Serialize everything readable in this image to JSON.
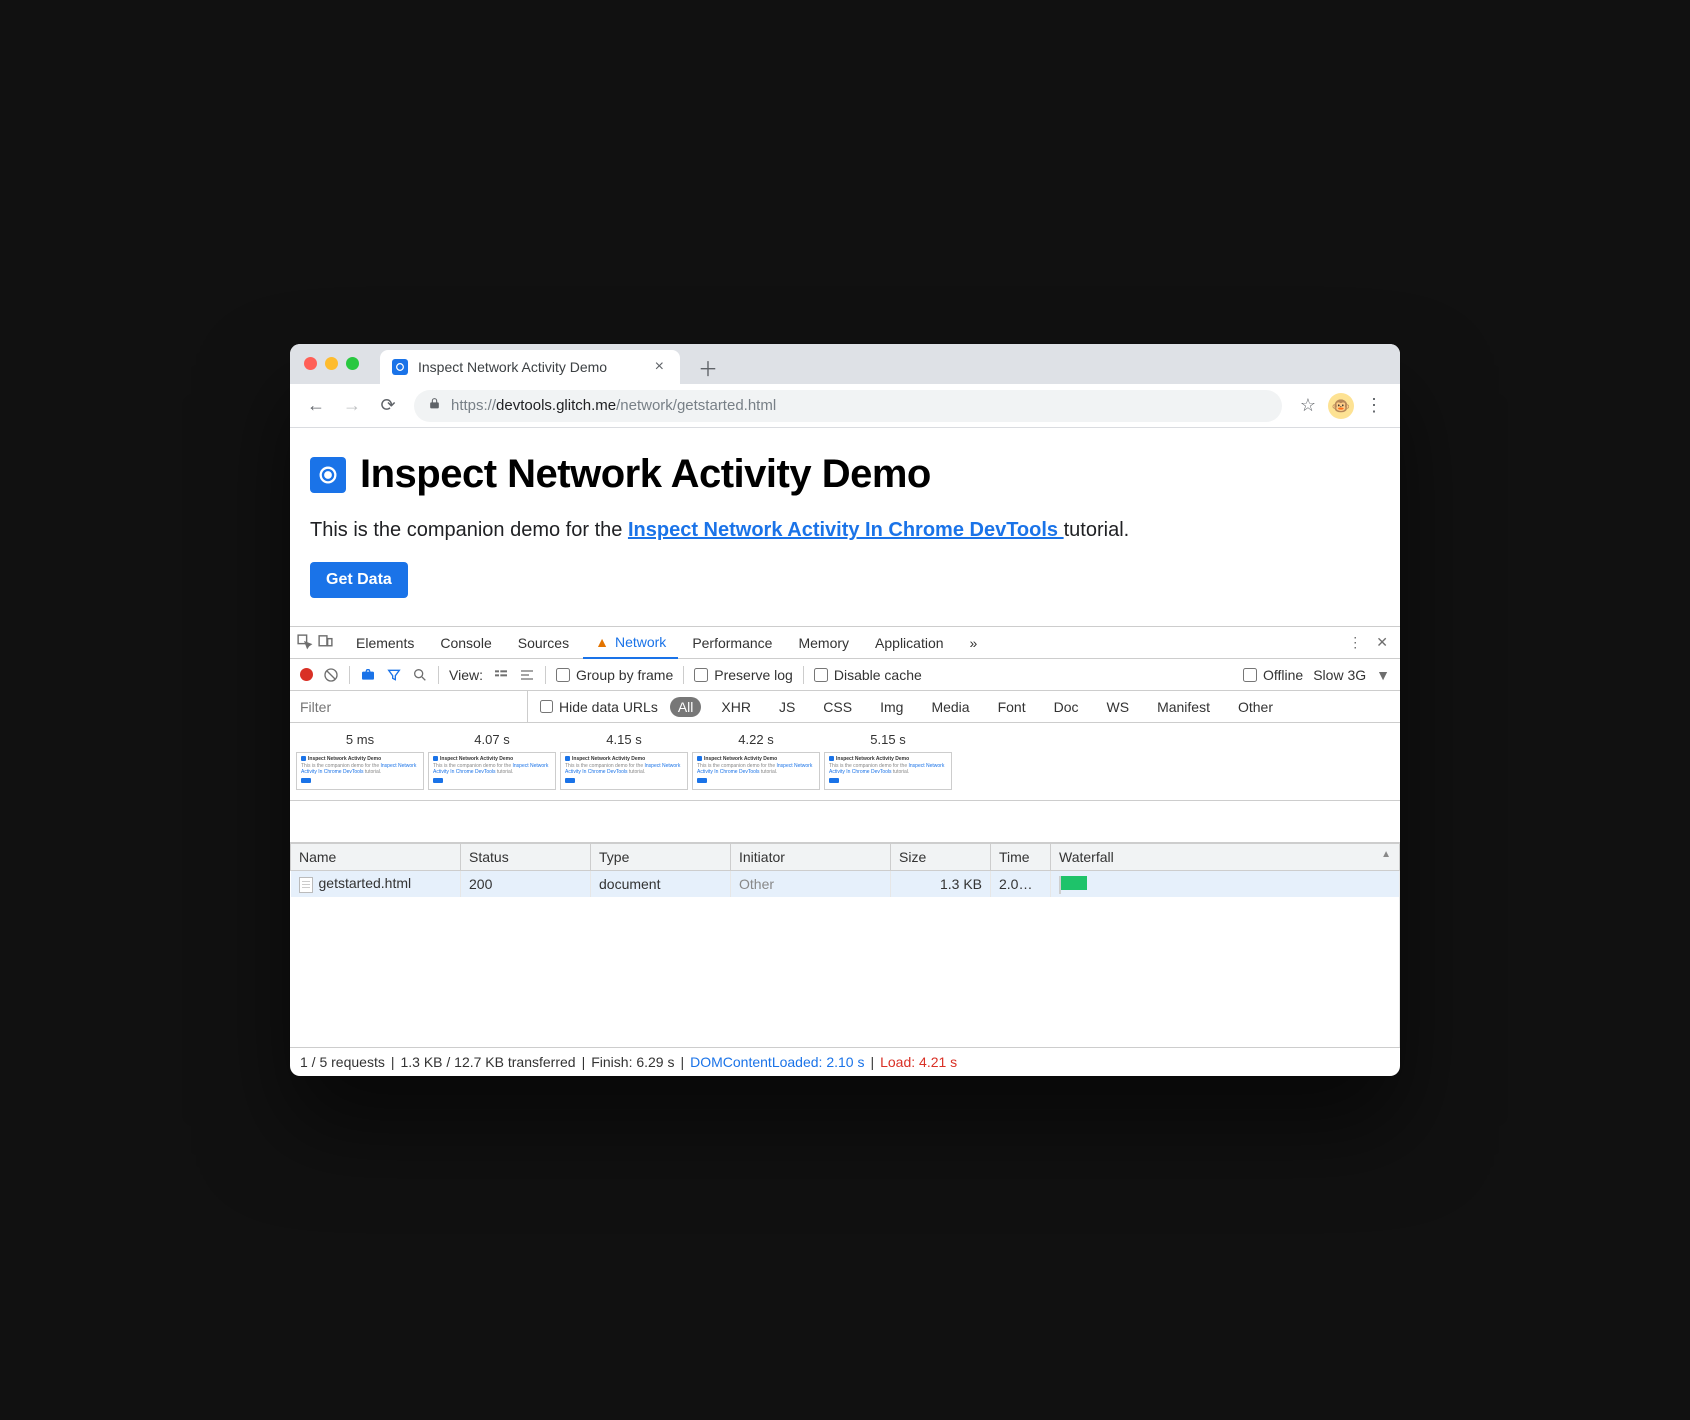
{
  "browser": {
    "tab_title": "Inspect Network Activity Demo",
    "url_display": {
      "scheme": "https://",
      "host": "devtools.glitch.me",
      "path": "/network/getstarted.html"
    }
  },
  "page": {
    "heading": "Inspect Network Activity Demo",
    "intro_prefix": "This is the companion demo for the ",
    "intro_link": "Inspect Network Activity In Chrome DevTools ",
    "intro_suffix": "tutorial.",
    "button": "Get Data"
  },
  "devtools": {
    "tabs": [
      "Elements",
      "Console",
      "Sources",
      "Network",
      "Performance",
      "Memory",
      "Application"
    ],
    "active_tab": "Network",
    "toolbar": {
      "view_label": "View:",
      "group_by_frame": "Group by frame",
      "preserve_log": "Preserve log",
      "disable_cache": "Disable cache",
      "offline": "Offline",
      "throttle": "Slow 3G"
    },
    "filterbar": {
      "placeholder": "Filter",
      "hide_data_urls": "Hide data URLs",
      "types": [
        "All",
        "XHR",
        "JS",
        "CSS",
        "Img",
        "Media",
        "Font",
        "Doc",
        "WS",
        "Manifest",
        "Other"
      ],
      "active_type": "All"
    },
    "filmstrip": [
      "5 ms",
      "4.07 s",
      "4.15 s",
      "4.22 s",
      "5.15 s"
    ],
    "columns": [
      "Name",
      "Status",
      "Type",
      "Initiator",
      "Size",
      "Time",
      "Waterfall"
    ],
    "rows": [
      {
        "name": "getstarted.html",
        "status": "200",
        "type": "document",
        "initiator": "Other",
        "size": "1.3 KB",
        "time": "2.0…"
      }
    ],
    "status": {
      "requests": "1 / 5 requests",
      "transferred": "1.3 KB / 12.7 KB transferred",
      "finish": "Finish: 6.29 s",
      "dcl": "DOMContentLoaded: 2.10 s",
      "load": "Load: 4.21 s"
    }
  }
}
